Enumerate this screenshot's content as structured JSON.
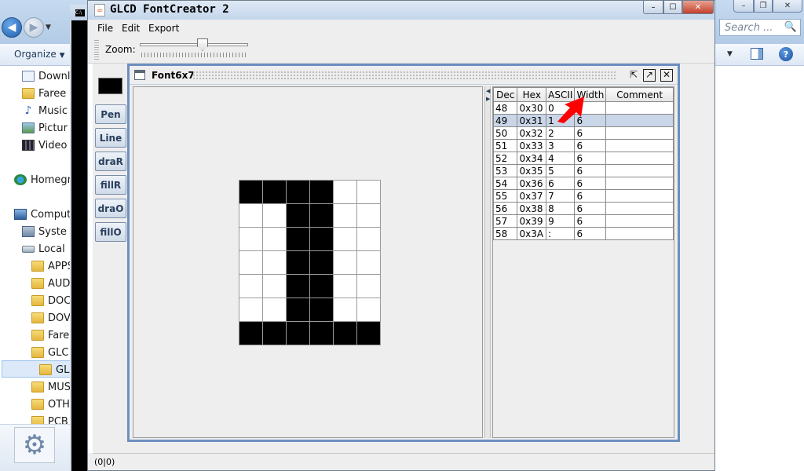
{
  "explorer": {
    "search_placeholder": "Search ...",
    "organize_label": "Organize",
    "nav_items": [
      {
        "label": "Downl",
        "icon": "downloads-icon"
      },
      {
        "label": "Faree",
        "icon": "folder-icon"
      },
      {
        "label": "Music",
        "icon": "music-icon"
      },
      {
        "label": "Pictur",
        "icon": "pictures-icon"
      },
      {
        "label": "Video",
        "icon": "videos-icon"
      },
      {
        "label": "Homegr",
        "icon": "homegroup-icon"
      },
      {
        "label": "Comput",
        "icon": "computer-icon"
      },
      {
        "label": "Syste",
        "icon": "system-icon"
      },
      {
        "label": "Local",
        "icon": "disk-icon"
      },
      {
        "label": "APPS",
        "icon": "folder-icon"
      },
      {
        "label": "AUD",
        "icon": "folder-icon"
      },
      {
        "label": "DOC",
        "icon": "folder-icon"
      },
      {
        "label": "DOV",
        "icon": "folder-icon"
      },
      {
        "label": "Fare",
        "icon": "folder-icon"
      },
      {
        "label": "GLC",
        "icon": "folder-icon"
      },
      {
        "label": "GL",
        "icon": "folder-icon"
      },
      {
        "label": "MUS",
        "icon": "folder-icon"
      },
      {
        "label": "OTH",
        "icon": "folder-icon"
      },
      {
        "label": "PCB",
        "icon": "folder-icon"
      }
    ]
  },
  "app": {
    "title": "GLCD FontCreator 2",
    "menus": [
      "File",
      "Edit",
      "Export"
    ],
    "zoom_label": "Zoom:",
    "zoom_level": 0.6,
    "tools": [
      "Pen",
      "Line",
      "draR",
      "fillR",
      "draO",
      "fillO"
    ],
    "status": "(0|0)"
  },
  "font_window": {
    "title": "Font6x7",
    "glyph": {
      "columns": 6,
      "rows": 7,
      "pixels": [
        [
          1,
          1,
          1,
          1,
          0,
          0
        ],
        [
          0,
          0,
          1,
          1,
          0,
          0
        ],
        [
          0,
          0,
          1,
          1,
          0,
          0
        ],
        [
          0,
          0,
          1,
          1,
          0,
          0
        ],
        [
          0,
          0,
          1,
          1,
          0,
          0
        ],
        [
          0,
          0,
          1,
          1,
          0,
          0
        ],
        [
          1,
          1,
          1,
          1,
          1,
          1
        ]
      ]
    },
    "table": {
      "headers": [
        "Dec",
        "Hex",
        "ASCII",
        "Width",
        "Comment"
      ],
      "selected_row": 1,
      "rows": [
        [
          "48",
          "0x30",
          "0",
          "6",
          ""
        ],
        [
          "49",
          "0x31",
          "1",
          "6",
          ""
        ],
        [
          "50",
          "0x32",
          "2",
          "6",
          ""
        ],
        [
          "51",
          "0x33",
          "3",
          "6",
          ""
        ],
        [
          "52",
          "0x34",
          "4",
          "6",
          ""
        ],
        [
          "53",
          "0x35",
          "5",
          "6",
          ""
        ],
        [
          "54",
          "0x36",
          "6",
          "6",
          ""
        ],
        [
          "55",
          "0x37",
          "7",
          "6",
          ""
        ],
        [
          "56",
          "0x38",
          "8",
          "6",
          ""
        ],
        [
          "57",
          "0x39",
          "9",
          "6",
          ""
        ],
        [
          "58",
          "0x3A",
          ":",
          "6",
          ""
        ]
      ]
    }
  },
  "colors": {
    "selection": "#c9d6e8",
    "pixel_on": "#000000",
    "pixel_off": "#ffffff",
    "annotation_arrow": "#ff0000"
  }
}
